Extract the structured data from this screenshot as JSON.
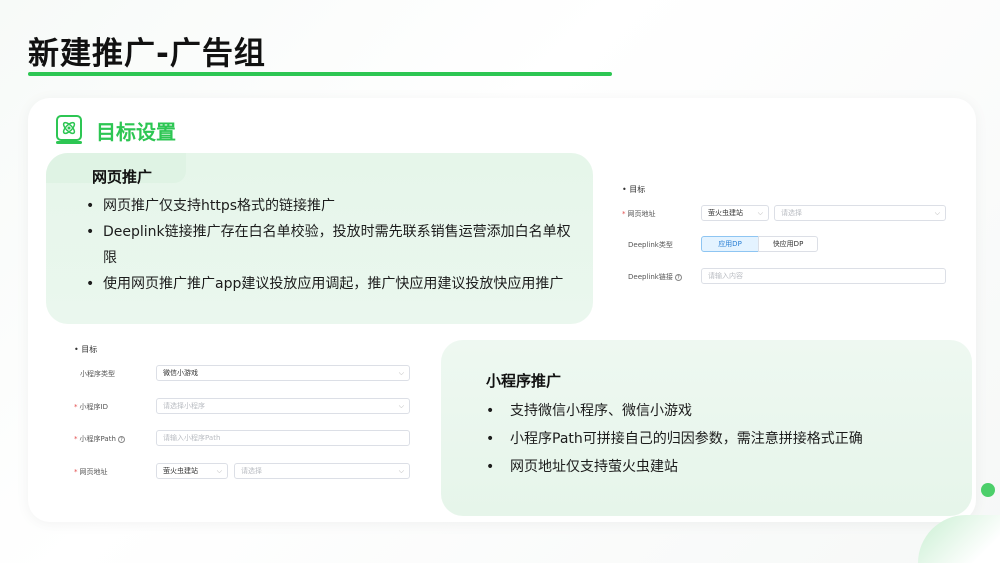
{
  "header": {
    "title": "新建推广-广告组"
  },
  "section": {
    "title": "目标设置",
    "icon": "atom-icon"
  },
  "web_card": {
    "heading": "网页推广",
    "bullets": [
      "网页推广仅支持https格式的链接推广",
      "Deeplink链接推广存在白名单校验，投放时需先联系销售运营添加白名单权限",
      "使用网页推广推广app建议投放应用调起，推广快应用建议投放快应用推广"
    ]
  },
  "mini_card": {
    "heading": "小程序推广",
    "bullets": [
      "支持微信小程序、微信小游戏",
      "小程序Path可拼接自己的归因参数，需注意拼接格式正确",
      "网页地址仅支持萤火虫建站"
    ]
  },
  "form_a": {
    "section": "目标",
    "url_label": "网页地址",
    "url_type": "萤火虫建站",
    "url_placeholder": "请选择",
    "deeplink_type_label": "Deeplink类型",
    "deeplink_type_options": [
      "应用DP",
      "快应用DP"
    ],
    "deeplink_link_label": "Deeplink链接",
    "deeplink_placeholder": "请输入内容"
  },
  "form_b": {
    "section": "目标",
    "mini_type_label": "小程序类型",
    "mini_type_value": "微信小游戏",
    "mini_id_label": "小程序ID",
    "mini_id_placeholder": "请选择小程序",
    "mini_path_label": "小程序Path",
    "mini_path_placeholder": "请输入小程序Path",
    "url_label": "网页地址",
    "url_type": "萤火虫建站",
    "url_placeholder": "请选择"
  },
  "colors": {
    "accent": "#2dc653",
    "card_bg": "#e6f6ea",
    "active_seg": "#2a7fd4",
    "required": "#e34d4d"
  }
}
